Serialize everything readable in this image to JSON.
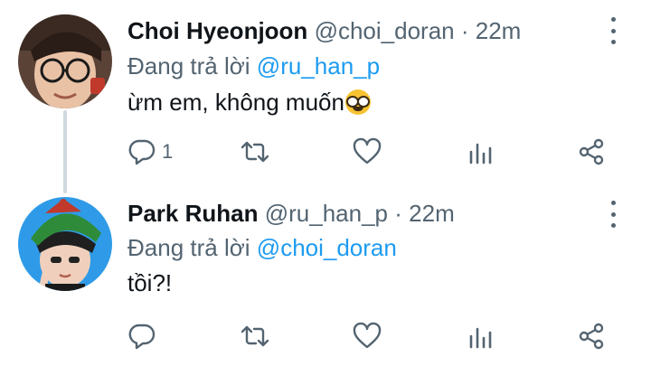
{
  "tweets": [
    {
      "name": "Choi Hyeonjoon",
      "handle": "@choi_doran",
      "dot": "·",
      "time": "22m",
      "reply_prefix": "Đang trả lời",
      "reply_to": "@ru_han_p",
      "text": "ừm em, không muốn",
      "emoji": "nerd-face-emoji",
      "reply_count": "1"
    },
    {
      "name": "Park Ruhan",
      "handle": "@ru_han_p",
      "dot": "·",
      "time": "22m",
      "reply_prefix": "Đang trả lời",
      "reply_to": "@choi_doran",
      "text": "tồi?!",
      "reply_count": ""
    }
  ],
  "colors": {
    "text": "#0f1419",
    "secondary": "#536471",
    "mention": "#1d9bf0",
    "thread_line": "#cfd9de"
  },
  "icons": [
    "reply-icon",
    "retweet-icon",
    "like-icon",
    "stats-icon",
    "share-icon",
    "more-options-icon"
  ]
}
